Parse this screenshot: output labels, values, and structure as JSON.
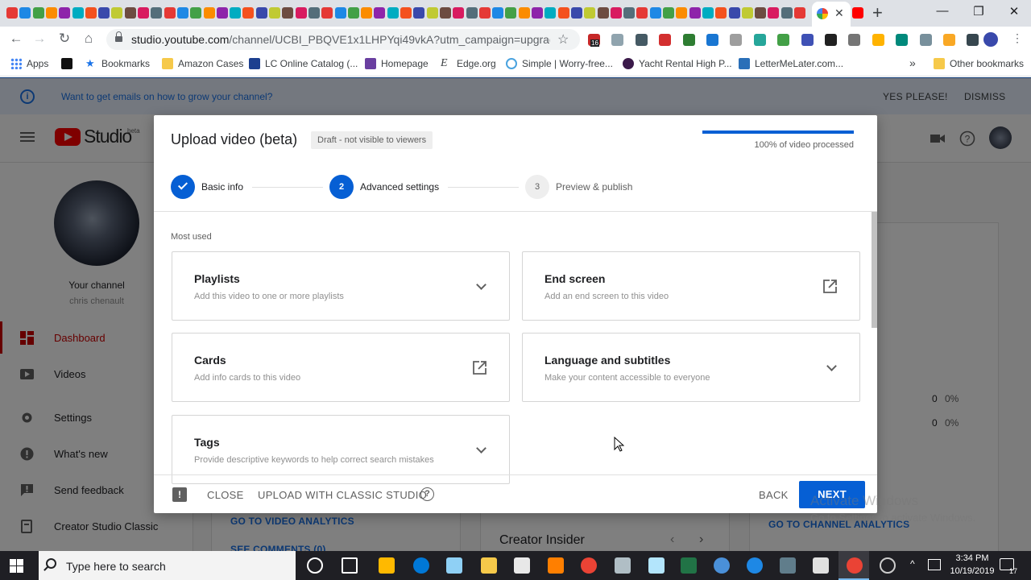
{
  "browser": {
    "active_tab_close": "✕",
    "new_tab": "+",
    "window_controls": [
      "—",
      "❐",
      "✕"
    ],
    "url_host": "studio.youtube.com",
    "url_rest": "/channel/UCBI_PBQVE1x1LHPYqi49vkA?utm_campaign=upgrade&u...",
    "bookmarks": [
      {
        "label": "Apps",
        "icon": "apps-grid-icon"
      },
      {
        "label": "",
        "icon": "amazon-icon"
      },
      {
        "label": "Bookmarks",
        "icon": "star-icon"
      },
      {
        "label": "Amazon Cases",
        "icon": "folder-icon"
      },
      {
        "label": "LC Online Catalog (...",
        "icon": "lc-icon"
      },
      {
        "label": "Homepage",
        "icon": "t-icon"
      },
      {
        "label": "Edge.org",
        "icon": "e-icon"
      },
      {
        "label": "Simple | Worry-free...",
        "icon": "simple-icon"
      },
      {
        "label": "Yacht Rental High P...",
        "icon": "yacht-icon"
      },
      {
        "label": "LetterMeLater.com...",
        "icon": "letter-icon"
      }
    ],
    "overflow": "»",
    "other_bookmarks": "Other bookmarks",
    "ext_badge": "16"
  },
  "banner": {
    "message": "Want to get emails on how to grow your channel?",
    "yes": "YES PLEASE!",
    "dismiss": "DISMISS"
  },
  "studio": {
    "logo_word": "Studio",
    "beta": "beta"
  },
  "sidebar": {
    "your_channel": "Your channel",
    "channel_name": "chris chenault",
    "items": [
      {
        "label": "Dashboard",
        "icon": "dashboard-icon",
        "active": true
      },
      {
        "label": "Videos",
        "icon": "videos-icon"
      },
      {
        "label": "Settings",
        "icon": "settings-gear-icon"
      },
      {
        "label": "What's new",
        "icon": "whats-new-icon"
      },
      {
        "label": "Send feedback",
        "icon": "feedback-icon"
      },
      {
        "label": "Creator Studio Classic",
        "icon": "classic-icon"
      }
    ]
  },
  "background": {
    "go_to_video_analytics": "GO TO VIDEO ANALYTICS",
    "see_comments": "SEE COMMENTS (0)",
    "creator_insider": "Creator Insider",
    "go_to_channel_analytics": "GO TO CHANNEL ANALYTICS",
    "stat1": "0",
    "stat1_pct": "0%",
    "stat2": "0",
    "stat2_pct": "0%"
  },
  "dialog": {
    "title": "Upload video (beta)",
    "draft_badge": "Draft - not visible to viewers",
    "progress_text": "100% of video processed",
    "progress_value": 1.0,
    "steps": [
      {
        "number": "1",
        "label": "Basic info",
        "state": "done"
      },
      {
        "number": "2",
        "label": "Advanced settings",
        "state": "current"
      },
      {
        "number": "3",
        "label": "Preview & publish",
        "state": "todo"
      }
    ],
    "section_label": "Most used",
    "options": [
      {
        "title": "Playlists",
        "subtitle": "Add this video to one or more playlists",
        "icon": "chevron-down-icon"
      },
      {
        "title": "End screen",
        "subtitle": "Add an end screen to this video",
        "icon": "open-external-icon"
      },
      {
        "title": "Cards",
        "subtitle": "Add info cards to this video",
        "icon": "open-external-icon"
      },
      {
        "title": "Language and subtitles",
        "subtitle": "Make your content accessible to everyone",
        "icon": "chevron-down-icon"
      },
      {
        "title": "Tags",
        "subtitle": "Provide descriptive keywords to help correct search mistakes",
        "icon": "chevron-down-icon"
      }
    ],
    "close": "CLOSE",
    "upload_classic": "UPLOAD WITH CLASSIC STUDIO",
    "back": "BACK",
    "next": "NEXT"
  },
  "watermark": {
    "line1": "Activate Windows",
    "line2": "Go to Settings to activate Windows."
  },
  "taskbar": {
    "search_placeholder": "Type here to search",
    "time": "3:34 PM",
    "date": "10/19/2019",
    "notifications": "17"
  },
  "colors": {
    "accent": "#065fd4",
    "youtube_red": "#ff0000",
    "active_nav": "#cc0000"
  }
}
